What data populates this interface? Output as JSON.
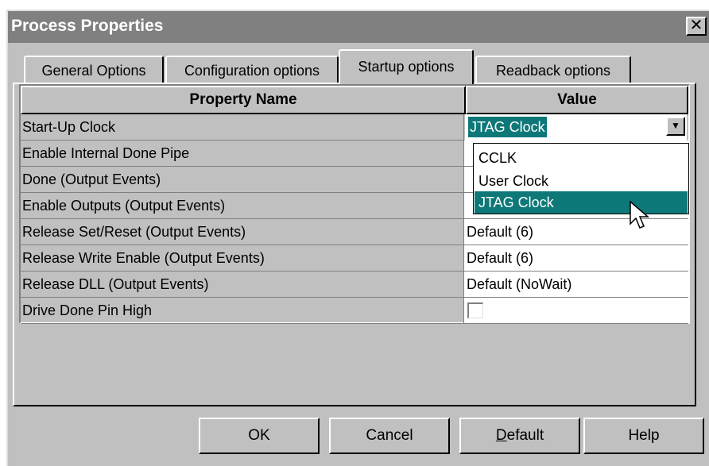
{
  "window": {
    "title": "Process Properties",
    "close_glyph": "✕"
  },
  "tabs": [
    {
      "label": "General Options",
      "active": false
    },
    {
      "label": "Configuration options",
      "active": false
    },
    {
      "label": "Startup options",
      "active": true
    },
    {
      "label": "Readback options",
      "active": false
    }
  ],
  "table": {
    "headers": {
      "name": "Property Name",
      "value": "Value"
    },
    "rows": [
      {
        "name": "Start-Up Clock",
        "value": "JTAG Clock"
      },
      {
        "name": "Enable Internal Done Pipe",
        "value": ""
      },
      {
        "name": "Done (Output Events)",
        "value": ""
      },
      {
        "name": "Enable Outputs (Output Events)",
        "value": ""
      },
      {
        "name": "Release Set/Reset (Output Events)",
        "value": "Default (6)"
      },
      {
        "name": "Release Write Enable (Output Events)",
        "value": "Default (6)"
      },
      {
        "name": "Release DLL (Output Events)",
        "value": "Default (NoWait)"
      },
      {
        "name": "Drive Done Pin High",
        "value": ""
      }
    ]
  },
  "dropdown": {
    "options": [
      "CCLK",
      "User Clock",
      "JTAG Clock"
    ],
    "highlighted": "JTAG Clock",
    "arrow_glyph": "▼"
  },
  "buttons": {
    "ok": "OK",
    "cancel": "Cancel",
    "default_mnemonic": "D",
    "default_rest": "efault",
    "help": "Help"
  },
  "colors": {
    "face": "#c0c0c0",
    "titlebar": "#808080",
    "highlight": "#0e7878"
  }
}
